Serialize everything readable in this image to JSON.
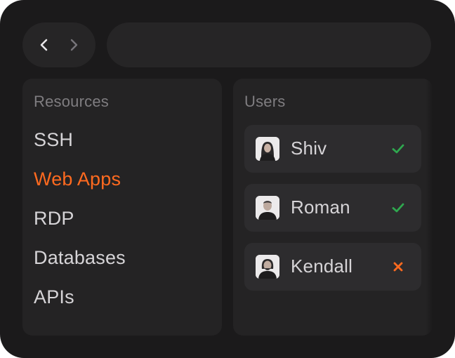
{
  "nav": {
    "back_icon": "chevron-left-icon",
    "forward_icon": "chevron-right-icon"
  },
  "address_bar": {
    "value": ""
  },
  "resources": {
    "title": "Resources",
    "items": [
      {
        "label": "SSH",
        "active": false
      },
      {
        "label": "Web Apps",
        "active": true
      },
      {
        "label": "RDP",
        "active": false
      },
      {
        "label": "Databases",
        "active": false
      },
      {
        "label": "APIs",
        "active": false
      }
    ]
  },
  "users": {
    "title": "Users",
    "items": [
      {
        "name": "Shiv",
        "status": "allowed",
        "status_icon": "check-icon"
      },
      {
        "name": "Roman",
        "status": "allowed",
        "status_icon": "check-icon"
      },
      {
        "name": "Kendall",
        "status": "denied",
        "status_icon": "cross-icon"
      }
    ]
  },
  "colors": {
    "background": "#1b1a1b",
    "panel": "#242324",
    "card": "#2d2c2e",
    "accent": "#ff6a1f",
    "allowed": "#2fa84f",
    "denied": "#ff6a1f",
    "muted_text": "#7f7d80",
    "text": "#d6d4d7"
  }
}
